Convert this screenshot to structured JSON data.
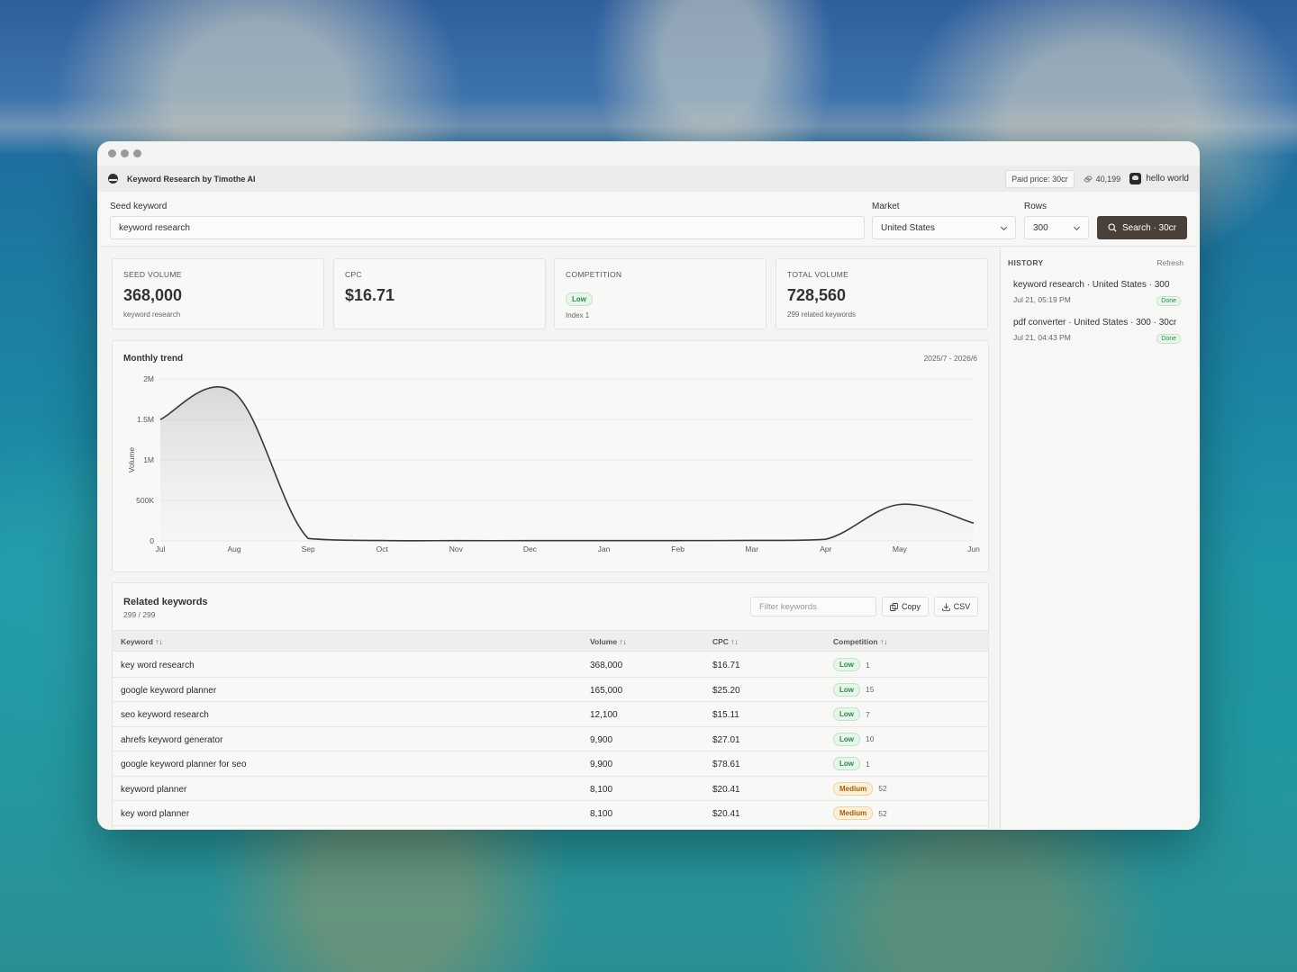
{
  "app": {
    "name": "Keyword Research by Timothe AI",
    "paid_price": "Paid price: 30cr",
    "credits": "40,199",
    "user": "hello world"
  },
  "search": {
    "seed_label": "Seed keyword",
    "seed_value": "keyword research",
    "market_label": "Market",
    "market_value": "United States",
    "rows_label": "Rows",
    "rows_value": "300",
    "button_label": "Search · 30cr"
  },
  "stats": [
    {
      "title": "SEED VOLUME",
      "value": "368,000",
      "sub": "keyword research"
    },
    {
      "title": "CPC",
      "value": "$16.71"
    },
    {
      "title": "COMPETITION",
      "badge": "Low",
      "sub": "Index 1"
    },
    {
      "title": "TOTAL VOLUME",
      "value": "728,560",
      "sub": "299 related keywords"
    }
  ],
  "chart_data": {
    "type": "area",
    "title": "Monthly trend",
    "range": "2025/7 - 2026/6",
    "ylabel": "Volume",
    "xlabel": "",
    "categories": [
      "Jul",
      "Aug",
      "Sep",
      "Oct",
      "Nov",
      "Dec",
      "Jan",
      "Feb",
      "Mar",
      "Apr",
      "May",
      "Jun"
    ],
    "values": [
      1500000,
      1830000,
      30000,
      5000,
      3000,
      3000,
      3000,
      4000,
      6000,
      20000,
      450000,
      220000
    ],
    "ylim": [
      0,
      2000000
    ],
    "yticks": [
      "0",
      "500K",
      "1M",
      "1.5M",
      "2M"
    ],
    "grid": true,
    "color": "#3a3a3a"
  },
  "related": {
    "title": "Related keywords",
    "count": "299 / 299",
    "filter_placeholder": "Filter keywords",
    "copy_label": "Copy",
    "csv_label": "CSV",
    "columns": [
      "Keyword ↑↓",
      "Volume ↑↓",
      "CPC ↑↓",
      "Competition ↑↓"
    ],
    "rows": [
      {
        "keyword": "key word research",
        "volume": "368,000",
        "cpc": "$16.71",
        "competition": "Low",
        "index": "1"
      },
      {
        "keyword": "google keyword planner",
        "volume": "165,000",
        "cpc": "$25.20",
        "competition": "Low",
        "index": "15"
      },
      {
        "keyword": "seo keyword research",
        "volume": "12,100",
        "cpc": "$15.11",
        "competition": "Low",
        "index": "7"
      },
      {
        "keyword": "ahrefs keyword generator",
        "volume": "9,900",
        "cpc": "$27.01",
        "competition": "Low",
        "index": "10"
      },
      {
        "keyword": "google keyword planner for seo",
        "volume": "9,900",
        "cpc": "$78.61",
        "competition": "Low",
        "index": "1"
      },
      {
        "keyword": "keyword planner",
        "volume": "8,100",
        "cpc": "$20.41",
        "competition": "Medium",
        "index": "52"
      },
      {
        "keyword": "key word planner",
        "volume": "8,100",
        "cpc": "$20.41",
        "competition": "Medium",
        "index": "52"
      }
    ]
  },
  "history": {
    "title": "HISTORY",
    "refresh": "Refresh",
    "items": [
      {
        "name": "keyword research · United States · 300",
        "time": "Jul 21, 05:19 PM",
        "status": "Done"
      },
      {
        "name": "pdf converter · United States · 300 · 30cr",
        "time": "Jul 21, 04:43 PM",
        "status": "Done"
      }
    ]
  },
  "colors": {
    "accent": "#4a403a",
    "low": "#2f8a47",
    "medium": "#a25d0c"
  }
}
